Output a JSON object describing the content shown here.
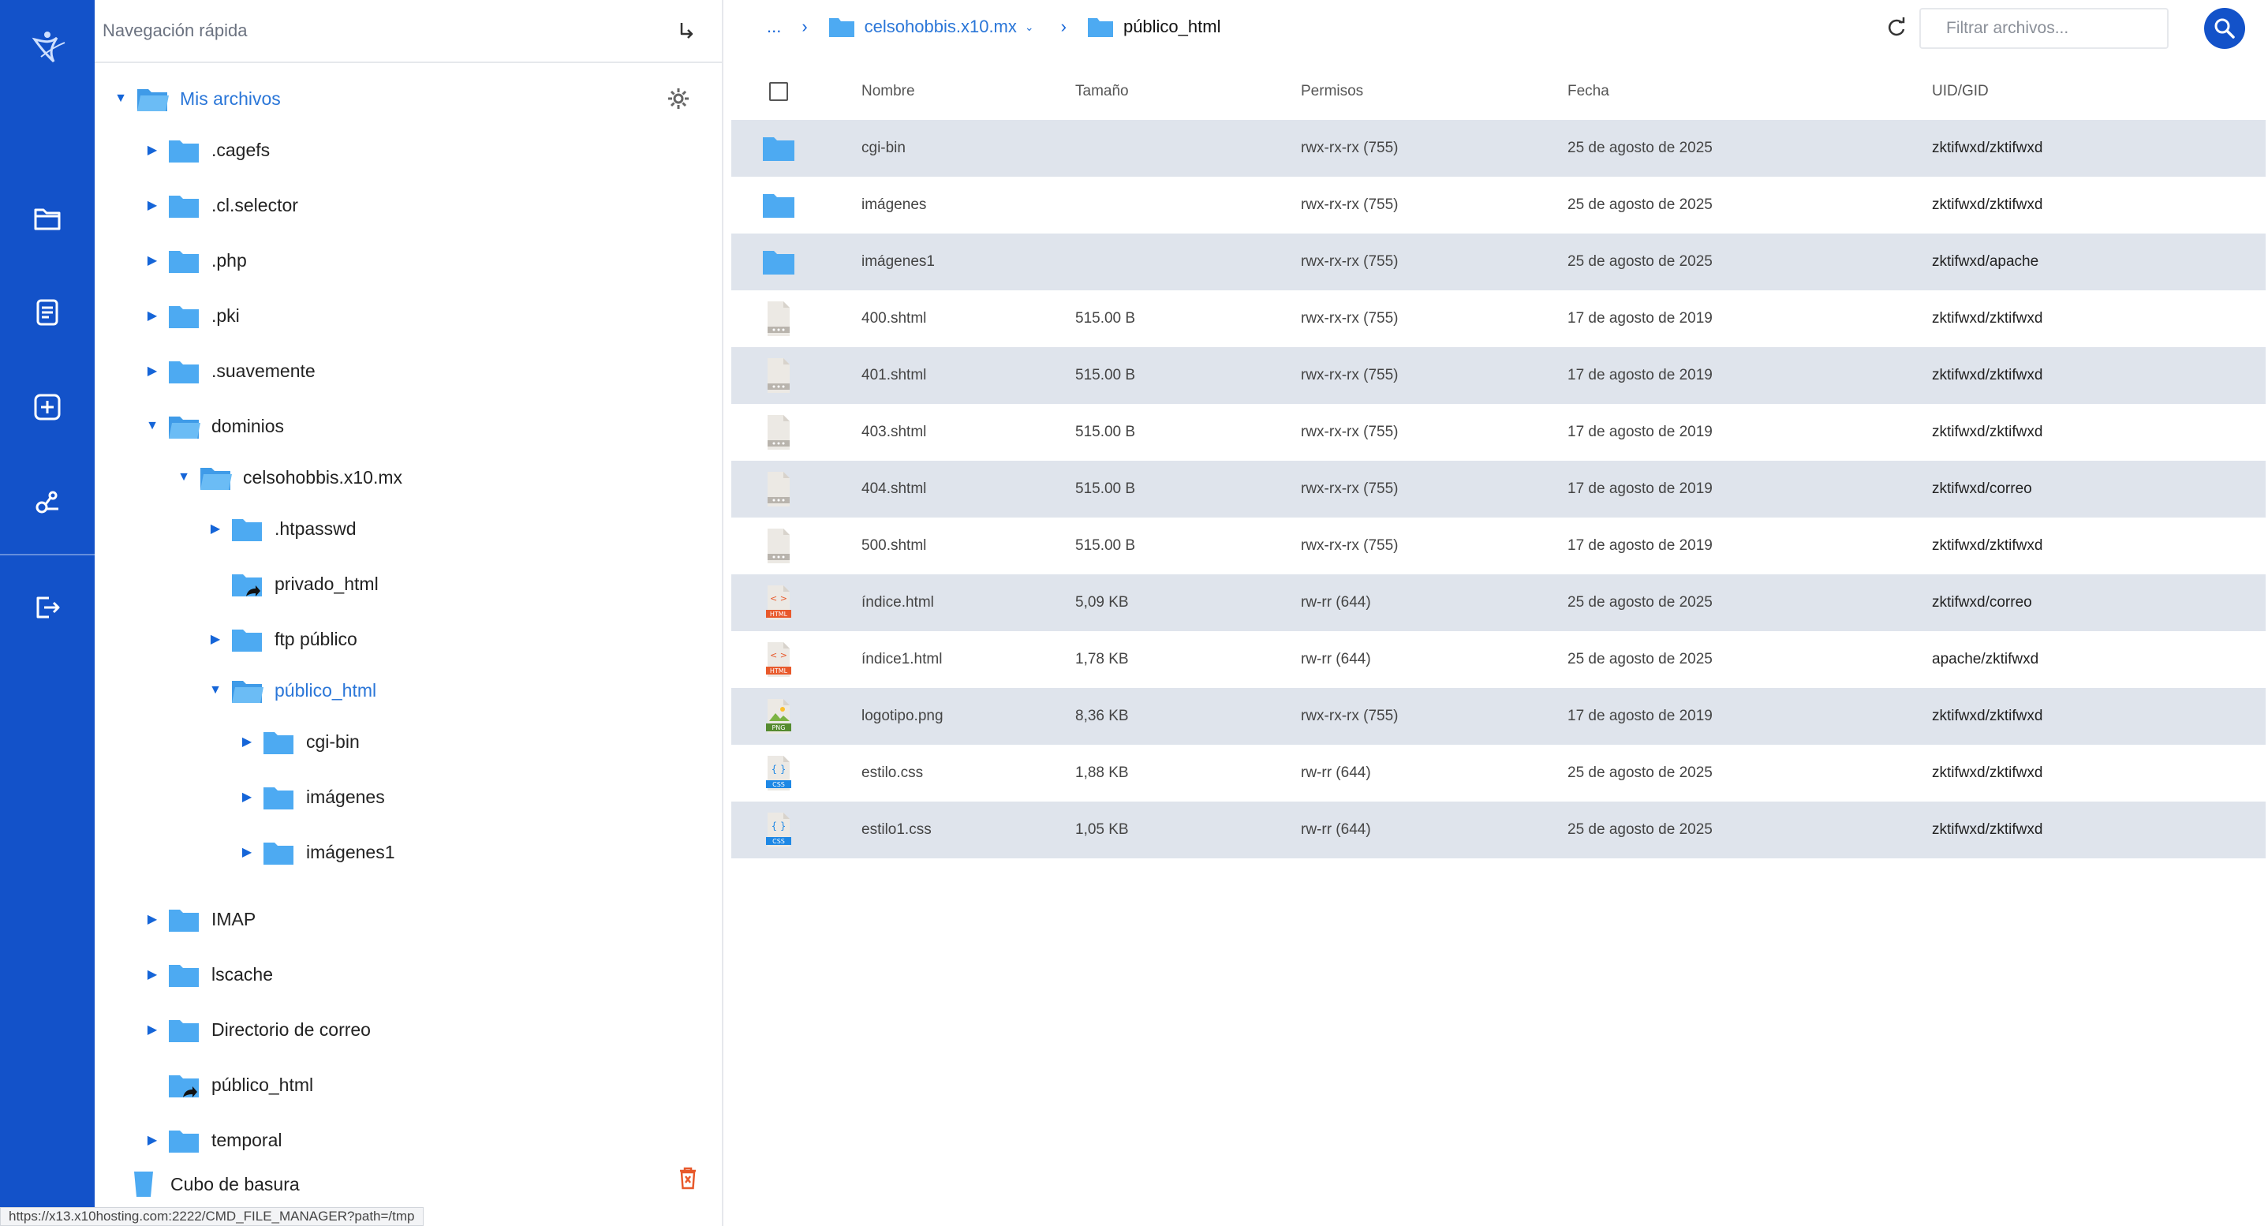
{
  "colors": {
    "accent": "#1352c9",
    "link": "#2a76d8",
    "folder": "#4daaf2",
    "row_alt": "#dfe4ec",
    "trash": "#e8592b"
  },
  "quicknav": {
    "placeholder": "Navegación rápida"
  },
  "tree": {
    "root": "Mis archivos",
    "items": [
      {
        "label": ".cagefs",
        "level": 1,
        "toggle": "collapsed",
        "icon": "folder-icon"
      },
      {
        "label": ".cl.selector",
        "level": 1,
        "toggle": "collapsed",
        "icon": "folder-icon"
      },
      {
        "label": ".php",
        "level": 1,
        "toggle": "collapsed",
        "icon": "folder-icon"
      },
      {
        "label": ".pki",
        "level": 1,
        "toggle": "collapsed",
        "icon": "folder-icon"
      },
      {
        "label": ".suavemente",
        "level": 1,
        "toggle": "collapsed",
        "icon": "folder-icon"
      },
      {
        "label": "dominios",
        "level": 1,
        "toggle": "expanded",
        "icon": "folder-open-icon"
      },
      {
        "label": "celsohobbis.x10.mx",
        "level": 2,
        "toggle": "expanded",
        "icon": "folder-open-icon"
      },
      {
        "label": ".htpasswd",
        "level": 3,
        "toggle": "collapsed",
        "icon": "folder-icon"
      },
      {
        "label": "privado_html",
        "level": 3,
        "toggle": "none",
        "icon": "folder-link-icon"
      },
      {
        "label": "ftp público",
        "level": 3,
        "toggle": "collapsed",
        "icon": "folder-icon"
      },
      {
        "label": "público_html",
        "level": 3,
        "toggle": "expanded",
        "icon": "folder-open-icon",
        "active": true
      },
      {
        "label": "cgi-bin",
        "level": 4,
        "toggle": "collapsed",
        "icon": "folder-icon"
      },
      {
        "label": "imágenes",
        "level": 4,
        "toggle": "collapsed",
        "icon": "folder-icon"
      },
      {
        "label": "imágenes1",
        "level": 4,
        "toggle": "collapsed",
        "icon": "folder-icon"
      },
      {
        "label": "IMAP",
        "level": 1,
        "toggle": "collapsed",
        "icon": "folder-icon"
      },
      {
        "label": "lscache",
        "level": 1,
        "toggle": "collapsed",
        "icon": "folder-icon"
      },
      {
        "label": "Directorio de correo",
        "level": 1,
        "toggle": "collapsed",
        "icon": "folder-icon"
      },
      {
        "label": "público_html",
        "level": 1,
        "toggle": "none",
        "icon": "folder-link-icon"
      },
      {
        "label": "temporal",
        "level": 1,
        "toggle": "collapsed",
        "icon": "folder-icon"
      }
    ],
    "trash": "Cubo de basura"
  },
  "breadcrumb": {
    "ellipsis": "...",
    "parent": "celsohobbis.x10.mx",
    "current": "público_html"
  },
  "filter": {
    "placeholder": "Filtrar archivos..."
  },
  "table": {
    "headers": {
      "name": "Nombre",
      "size": "Tamaño",
      "perms": "Permisos",
      "date": "Fecha",
      "uid": "UID/GID"
    },
    "rows": [
      {
        "icon": "folder-icon",
        "name": "cgi-bin",
        "size": "",
        "perms": "rwx-rx-rx (755)",
        "date": "25 de agosto de 2025",
        "uid": "zktifwxd/zktifwxd"
      },
      {
        "icon": "folder-icon",
        "name": "imágenes",
        "size": "",
        "perms": "rwx-rx-rx (755)",
        "date": "25 de agosto de 2025",
        "uid": "zktifwxd/zktifwxd"
      },
      {
        "icon": "folder-icon",
        "name": "imágenes1",
        "size": "",
        "perms": "rwx-rx-rx (755)",
        "date": "25 de agosto de 2025",
        "uid": "zktifwxd/apache"
      },
      {
        "icon": "generic-file-icon",
        "name": "400.shtml",
        "size": "515.00 B",
        "perms": "rwx-rx-rx (755)",
        "date": "17 de agosto de 2019",
        "uid": "zktifwxd/zktifwxd"
      },
      {
        "icon": "generic-file-icon",
        "name": "401.shtml",
        "size": "515.00 B",
        "perms": "rwx-rx-rx (755)",
        "date": "17 de agosto de 2019",
        "uid": "zktifwxd/zktifwxd"
      },
      {
        "icon": "generic-file-icon",
        "name": "403.shtml",
        "size": "515.00 B",
        "perms": "rwx-rx-rx (755)",
        "date": "17 de agosto de 2019",
        "uid": "zktifwxd/zktifwxd"
      },
      {
        "icon": "generic-file-icon",
        "name": "404.shtml",
        "size": "515.00 B",
        "perms": "rwx-rx-rx (755)",
        "date": "17 de agosto de 2019",
        "uid": "zktifwxd/correo"
      },
      {
        "icon": "generic-file-icon",
        "name": "500.shtml",
        "size": "515.00 B",
        "perms": "rwx-rx-rx (755)",
        "date": "17 de agosto de 2019",
        "uid": "zktifwxd/zktifwxd"
      },
      {
        "icon": "html-file-icon",
        "name": "índice.html",
        "size": "5,09 KB",
        "perms": "rw-rr (644)",
        "date": "25 de agosto de 2025",
        "uid": "zktifwxd/correo"
      },
      {
        "icon": "html-file-icon",
        "name": "índice1.html",
        "size": "1,78 KB",
        "perms": "rw-rr (644)",
        "date": "25 de agosto de 2025",
        "uid": "apache/zktifwxd"
      },
      {
        "icon": "png-file-icon",
        "name": "logotipo.png",
        "size": "8,36 KB",
        "perms": "rwx-rx-rx (755)",
        "date": "17 de agosto de 2019",
        "uid": "zktifwxd/zktifwxd"
      },
      {
        "icon": "css-file-icon",
        "name": "estilo.css",
        "size": "1,88 KB",
        "perms": "rw-rr (644)",
        "date": "25 de agosto de 2025",
        "uid": "zktifwxd/zktifwxd"
      },
      {
        "icon": "css-file-icon",
        "name": "estilo1.css",
        "size": "1,05 KB",
        "perms": "rw-rr (644)",
        "date": "25 de agosto de 2025",
        "uid": "zktifwxd/zktifwxd"
      }
    ]
  },
  "icon_labels": {
    "html": "HTML",
    "png": "PNG",
    "css": "CSS",
    "html_glyph": "< >",
    "css_glyph": "{ }"
  },
  "status_url": "https://x13.x10hosting.com:2222/CMD_FILE_MANAGER?path=/tmp"
}
